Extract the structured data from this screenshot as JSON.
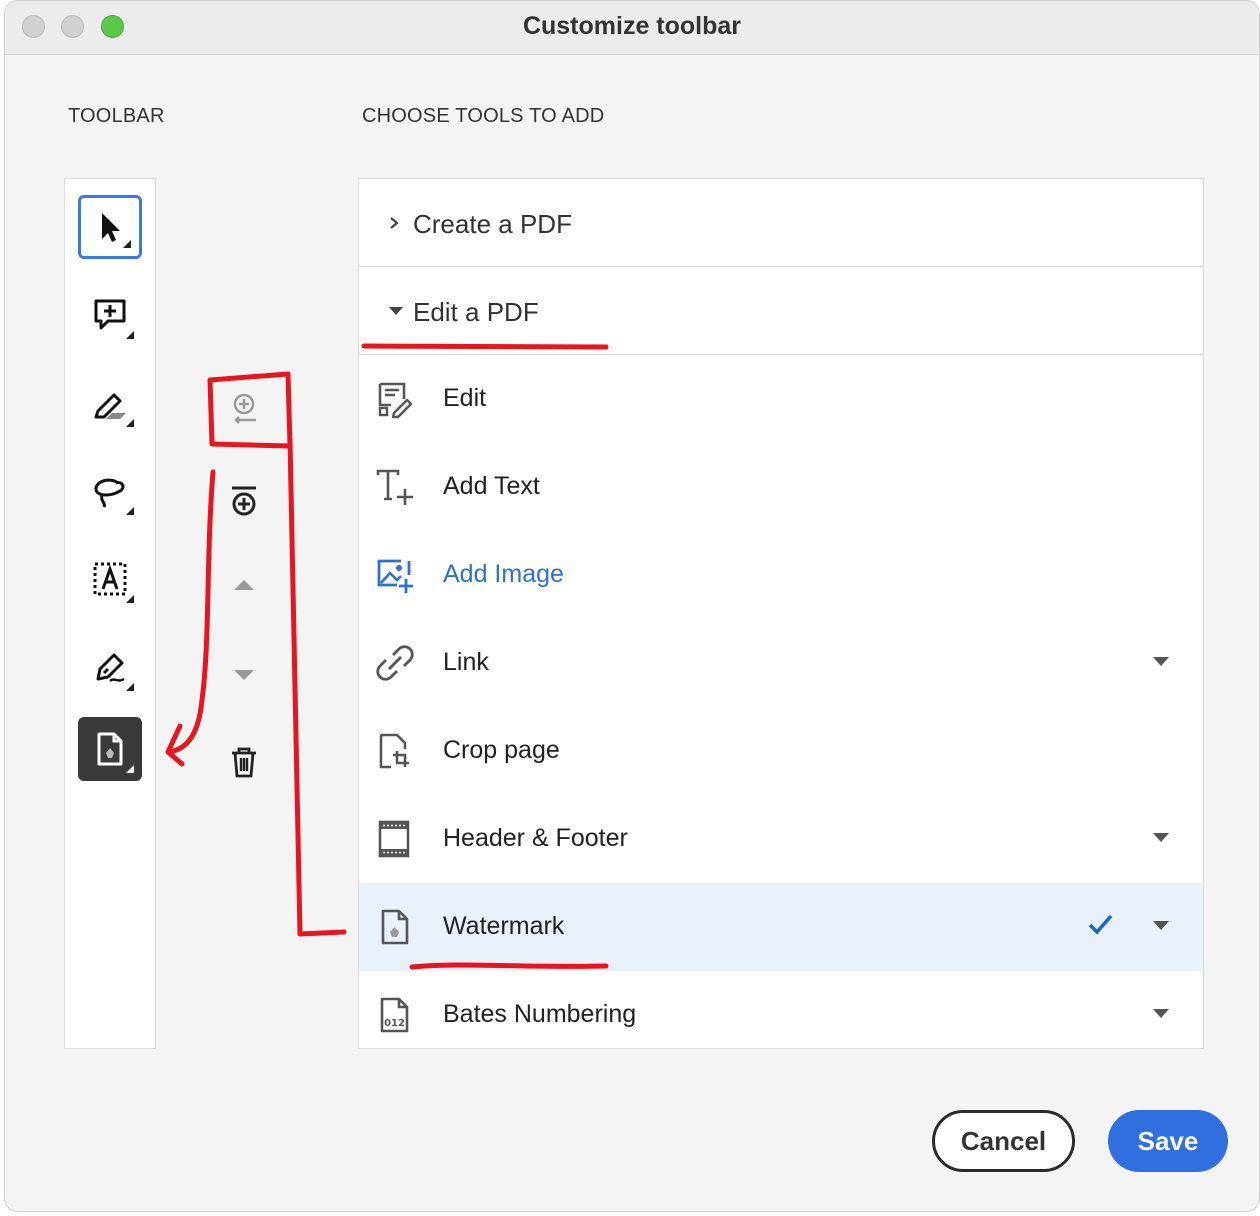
{
  "window": {
    "title": "Customize toolbar"
  },
  "sections": {
    "toolbar_heading": "TOOLBAR",
    "choose_heading": "CHOOSE TOOLS TO ADD"
  },
  "toolbar_items": [
    {
      "icon": "select-arrow-icon",
      "state": "selected"
    },
    {
      "icon": "add-comment-icon",
      "state": "normal"
    },
    {
      "icon": "highlight-pen-icon",
      "state": "normal"
    },
    {
      "icon": "lasso-draw-icon",
      "state": "normal"
    },
    {
      "icon": "text-box-icon",
      "state": "normal"
    },
    {
      "icon": "sign-pen-icon",
      "state": "normal"
    },
    {
      "icon": "watermark-icon",
      "state": "active"
    }
  ],
  "controls": [
    "add-to-toolbar-icon",
    "add-divider-icon",
    "move-up-icon",
    "move-down-icon",
    "delete-icon"
  ],
  "categories": [
    {
      "label": "Create a PDF",
      "expanded": false
    },
    {
      "label": "Edit a PDF",
      "expanded": true
    }
  ],
  "tools": [
    {
      "label": "Edit",
      "icon": "edit-document-icon",
      "dropdown": false,
      "checked": false
    },
    {
      "label": "Add Text",
      "icon": "add-text-icon",
      "dropdown": false,
      "checked": false
    },
    {
      "label": "Add Image",
      "icon": "add-image-icon",
      "dropdown": false,
      "checked": false,
      "color": "#2e73c4"
    },
    {
      "label": "Link",
      "icon": "link-icon",
      "dropdown": true,
      "checked": false
    },
    {
      "label": "Crop page",
      "icon": "crop-page-icon",
      "dropdown": false,
      "checked": false
    },
    {
      "label": "Header & Footer",
      "icon": "header-footer-icon",
      "dropdown": true,
      "checked": false
    },
    {
      "label": "Watermark",
      "icon": "watermark-icon",
      "dropdown": true,
      "checked": true,
      "highlighted": true
    },
    {
      "label": "Bates Numbering",
      "icon": "bates-numbering-icon",
      "dropdown": true,
      "checked": false,
      "icon_text": "012"
    }
  ],
  "buttons": {
    "cancel": "Cancel",
    "save": "Save"
  },
  "colors": {
    "accent": "#2f6fde",
    "annotation": "#e8141e",
    "highlight_row": "#e9f1fb"
  }
}
